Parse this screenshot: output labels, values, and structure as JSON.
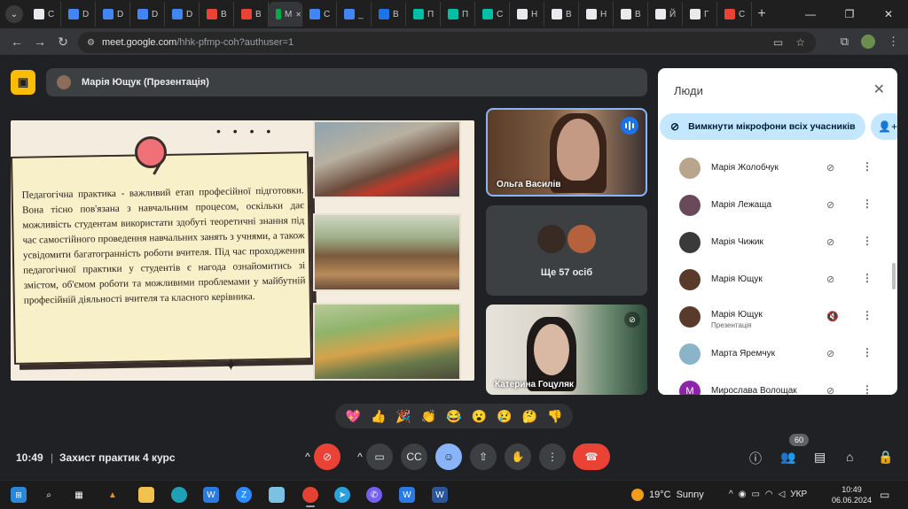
{
  "browser": {
    "tabs": [
      {
        "label": "С",
        "color": "#e8eaed"
      },
      {
        "label": "D",
        "color": "#4285f4"
      },
      {
        "label": "D",
        "color": "#4285f4"
      },
      {
        "label": "D",
        "color": "#4285f4"
      },
      {
        "label": "D",
        "color": "#4285f4"
      },
      {
        "label": "В",
        "color": "#ea4335"
      },
      {
        "label": "В",
        "color": "#ea4335"
      },
      {
        "label": "М",
        "color": "#00ac47",
        "active": true
      },
      {
        "label": "С",
        "color": "#4285f4"
      },
      {
        "label": "_",
        "color": "#4285f4"
      },
      {
        "label": "В",
        "color": "#1a73e8"
      },
      {
        "label": "П",
        "color": "#00bfa5"
      },
      {
        "label": "П",
        "color": "#00bfa5"
      },
      {
        "label": "С",
        "color": "#00bfa5"
      },
      {
        "label": "Н",
        "color": "#e8eaed"
      },
      {
        "label": "В",
        "color": "#e8eaed"
      },
      {
        "label": "Н",
        "color": "#e8eaed"
      },
      {
        "label": "В",
        "color": "#e8eaed"
      },
      {
        "label": "Й",
        "color": "#e8eaed"
      },
      {
        "label": "Г",
        "color": "#e8eaed"
      },
      {
        "label": "С",
        "color": "#ea4335"
      }
    ],
    "url_host": "meet.google.com",
    "url_path": "/hhk-pfmp-coh?authuser=1"
  },
  "meet": {
    "presenter_label": "Марія Ющук (Презентація)",
    "slide_text": "Педагогічна практика - важливий етап професійної підготовки. Вона тісно пов'язана з навчальним процесом, оскільки дає можливість студентам використати здобуті теоретичні знання під час самостійного проведення навчальних занять з учнями, а також усвідомити багатогранність роботи вчителя. Під час проходження педагогічної практики у студентів є нагода ознайомитись зі змістом, об'ємом роботи та можливими проблемами у майбутній професійній діяльності вчителя та класного керівника.",
    "tiles": {
      "speaker_name": "Ольга Василів",
      "more_count": "Ще 57 осіб",
      "third_name": "Катерина Гоцуляк"
    },
    "people_panel": {
      "title": "Люди",
      "mute_all": "Вимкнути мікрофони всіх учасників",
      "participants": [
        {
          "name": "Марія Жолобчук",
          "sub": "",
          "color": "#b9a48c",
          "mic": "off"
        },
        {
          "name": "Марія Лежаща",
          "sub": "",
          "color": "#6a4a5a",
          "mic": "off"
        },
        {
          "name": "Марія Чижик",
          "sub": "",
          "color": "#3a3a3a",
          "mic": "off"
        },
        {
          "name": "Марія Ющук",
          "sub": "",
          "color": "#5a3a2a",
          "mic": "off"
        },
        {
          "name": "Марія Ющук",
          "sub": "Презентація",
          "color": "#5a3a2a",
          "mic": "present"
        },
        {
          "name": "Марта Яремчук",
          "sub": "",
          "color": "#8ab4c8",
          "mic": "off"
        },
        {
          "name": "Мирослава Волощак",
          "sub": "",
          "color": "#8e24aa",
          "initial": "M",
          "mic": "off"
        }
      ]
    },
    "reactions": [
      "💖",
      "👍",
      "🎉",
      "👏",
      "😂",
      "😮",
      "😢",
      "🤔",
      "👎"
    ],
    "bottom": {
      "time": "10:49",
      "separator": "|",
      "meeting_name": "Захист практик 4 курс",
      "people_count": "60"
    }
  },
  "taskbar": {
    "weather_temp": "19°C",
    "weather_text": "Sunny",
    "lang": "УКР",
    "clock_time": "10:49",
    "clock_date": "06.06.2024"
  }
}
